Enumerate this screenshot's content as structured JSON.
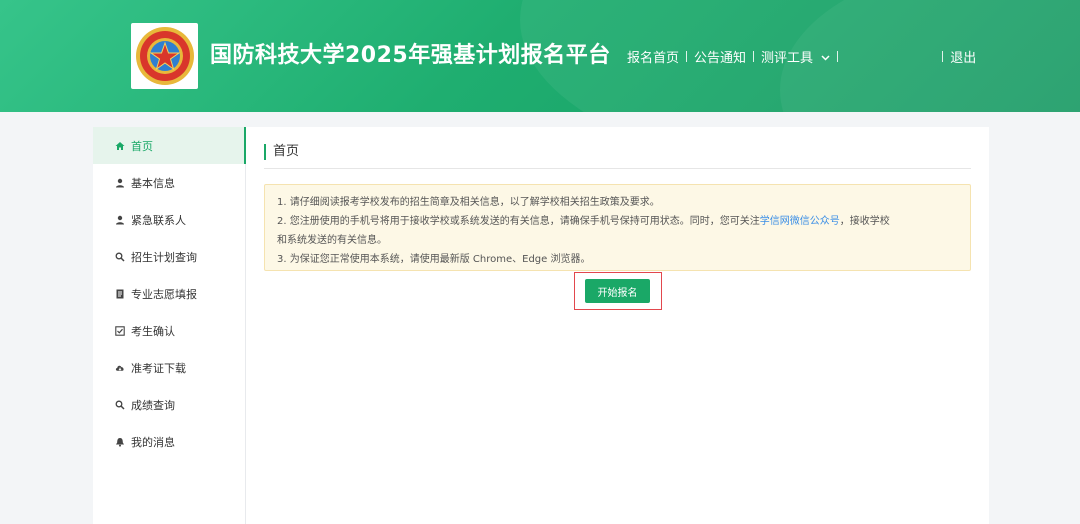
{
  "header": {
    "title": "国防科技大学2025年强基计划报名平台",
    "nav": [
      {
        "label": "报名首页"
      },
      {
        "label": "公告通知"
      },
      {
        "label": "测评工具"
      }
    ],
    "logout": "退出",
    "colors": {
      "start": "#36c48a",
      "end": "#169a62"
    }
  },
  "sidebar": {
    "items": [
      {
        "label": "首页",
        "icon": "home-icon",
        "active": true
      },
      {
        "label": "基本信息",
        "icon": "user-icon"
      },
      {
        "label": "紧急联系人",
        "icon": "user-icon"
      },
      {
        "label": "招生计划查询",
        "icon": "search-icon"
      },
      {
        "label": "专业志愿填报",
        "icon": "document-icon"
      },
      {
        "label": "考生确认",
        "icon": "checkbox-icon"
      },
      {
        "label": "准考证下载",
        "icon": "cloud-download-icon"
      },
      {
        "label": "成绩查询",
        "icon": "search-icon"
      },
      {
        "label": "我的消息",
        "icon": "bell-icon"
      }
    ]
  },
  "main": {
    "page_title": "首页",
    "notice": {
      "line1": "1. 请仔细阅读报考学校发布的招生简章及相关信息，以了解学校相关招生政策及要求。",
      "line2_pre": "2. 您注册使用的手机号将用于接收学校或系统发送的有关信息，请确保手机号保持可用状态。同时，您可关注",
      "line2_link": "学信网微信公众号",
      "line2_post": "，接收学校",
      "line2_cont": "和系统发送的有关信息。",
      "line3": "3. 为保证您正常使用本系统，请使用最新版 Chrome、Edge 浏览器。"
    },
    "start_button": "开始报名"
  },
  "colors": {
    "accent": "#1aa867",
    "highlight_border": "#e2474d",
    "link": "#3a8ee6"
  }
}
